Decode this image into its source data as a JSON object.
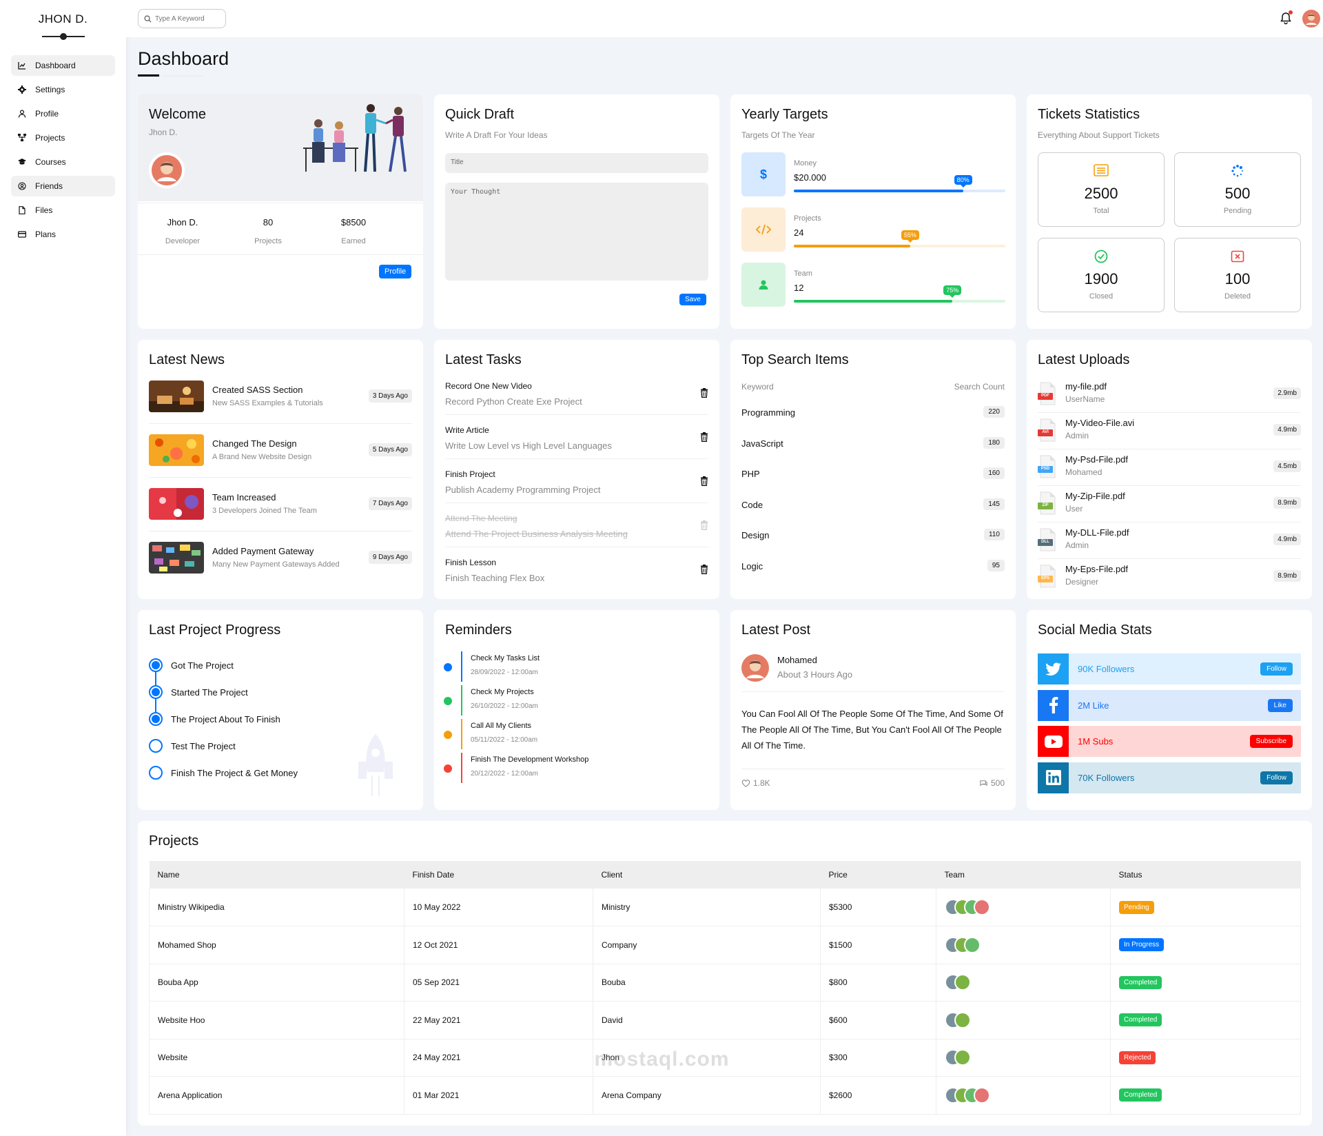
{
  "brand": "JHON D.",
  "nav": [
    {
      "label": "Dashboard",
      "icon": "chart-icon",
      "active": true
    },
    {
      "label": "Settings",
      "icon": "gear-icon",
      "active": false
    },
    {
      "label": "Profile",
      "icon": "user-icon",
      "active": false
    },
    {
      "label": "Projects",
      "icon": "diagram-icon",
      "active": false
    },
    {
      "label": "Courses",
      "icon": "graduation-cap-icon",
      "active": false
    },
    {
      "label": "Friends",
      "icon": "friends-icon",
      "active": true
    },
    {
      "label": "Files",
      "icon": "file-icon",
      "active": false
    },
    {
      "label": "Plans",
      "icon": "credit-card-icon",
      "active": false
    }
  ],
  "search": {
    "placeholder": "Type A Keyword"
  },
  "page_title": "Dashboard",
  "welcome": {
    "title": "Welcome",
    "name": "Jhon D.",
    "stats": [
      {
        "value": "Jhon D.",
        "label": "Developer"
      },
      {
        "value": "80",
        "label": "Projects"
      },
      {
        "value": "$8500",
        "label": "Earned"
      }
    ],
    "button": "Profile"
  },
  "quick_draft": {
    "title": "Quick Draft",
    "subtitle": "Write A Draft For Your Ideas",
    "title_placeholder": "Title",
    "body_placeholder": "Your Thought",
    "button": "Save"
  },
  "yearly_targets": {
    "title": "Yearly Targets",
    "subtitle": "Targets Of The Year",
    "items": [
      {
        "label": "Money",
        "value": "$20.000",
        "percent": 80,
        "badge": "80%",
        "color": "#0075ff",
        "bg": "#d7e9ff",
        "track": "#dceaff",
        "icon": "dollar-icon"
      },
      {
        "label": "Projects",
        "value": "24",
        "percent": 55,
        "badge": "55%",
        "color": "#f59e0b",
        "bg": "#fdecd6",
        "track": "#fdf0db",
        "icon": "code-icon"
      },
      {
        "label": "Team",
        "value": "12",
        "percent": 75,
        "badge": "75%",
        "color": "#22c55e",
        "bg": "#d8f5e1",
        "track": "#dcf5e4",
        "icon": "user-icon"
      }
    ]
  },
  "tickets": {
    "title": "Tickets Statistics",
    "subtitle": "Everything About Support Tickets",
    "items": [
      {
        "value": "2500",
        "label": "Total",
        "color": "#f59e0b",
        "icon": "list-icon"
      },
      {
        "value": "500",
        "label": "Pending",
        "color": "#0075ff",
        "icon": "spinner-icon"
      },
      {
        "value": "1900",
        "label": "Closed",
        "color": "#22c55e",
        "icon": "check-circle-icon"
      },
      {
        "value": "100",
        "label": "Deleted",
        "color": "#f44336",
        "icon": "x-square-icon"
      }
    ]
  },
  "latest_news": {
    "title": "Latest News",
    "items": [
      {
        "title": "Created SASS Section",
        "desc": "New SASS Examples & Tutorials",
        "time": "3 Days Ago"
      },
      {
        "title": "Changed The Design",
        "desc": "A Brand New Website Design",
        "time": "5 Days Ago"
      },
      {
        "title": "Team Increased",
        "desc": "3 Developers Joined The Team",
        "time": "7 Days Ago"
      },
      {
        "title": "Added Payment Gateway",
        "desc": "Many New Payment Gateways Added",
        "time": "9 Days Ago"
      }
    ]
  },
  "latest_tasks": {
    "title": "Latest Tasks",
    "items": [
      {
        "title": "Record One New Video",
        "desc": "Record Python Create Exe Project",
        "done": false
      },
      {
        "title": "Write Article",
        "desc": "Write Low Level vs High Level Languages",
        "done": false
      },
      {
        "title": "Finish Project",
        "desc": "Publish Academy Programming Project",
        "done": false
      },
      {
        "title": "Attend The Meeting",
        "desc": "Attend The Project Business Analysis Meeting",
        "done": true
      },
      {
        "title": "Finish Lesson",
        "desc": "Finish Teaching Flex Box",
        "done": false
      }
    ]
  },
  "top_search": {
    "title": "Top Search Items",
    "col_keyword": "Keyword",
    "col_count": "Search Count",
    "items": [
      {
        "keyword": "Programming",
        "count": "220"
      },
      {
        "keyword": "JavaScript",
        "count": "180"
      },
      {
        "keyword": "PHP",
        "count": "160"
      },
      {
        "keyword": "Code",
        "count": "145"
      },
      {
        "keyword": "Design",
        "count": "110"
      },
      {
        "keyword": "Logic",
        "count": "95"
      }
    ]
  },
  "latest_uploads": {
    "title": "Latest Uploads",
    "items": [
      {
        "name": "my-file.pdf",
        "user": "UserName",
        "size": "2.9mb",
        "ext": "PDF",
        "color": "#e53935"
      },
      {
        "name": "My-Video-File.avi",
        "user": "Admin",
        "size": "4.9mb",
        "ext": "AVI",
        "color": "#e53935"
      },
      {
        "name": "My-Psd-File.pdf",
        "user": "Mohamed",
        "size": "4.5mb",
        "ext": "PSD",
        "color": "#42a5f5"
      },
      {
        "name": "My-Zip-File.pdf",
        "user": "User",
        "size": "8.9mb",
        "ext": "ZIP",
        "color": "#7cb342"
      },
      {
        "name": "My-DLL-File.pdf",
        "user": "Admin",
        "size": "4.9mb",
        "ext": "DLL",
        "color": "#546e7a"
      },
      {
        "name": "My-Eps-File.pdf",
        "user": "Designer",
        "size": "8.9mb",
        "ext": "EPS",
        "color": "#ffb74d"
      }
    ]
  },
  "project_progress": {
    "title": "Last Project Progress",
    "items": [
      {
        "label": "Got The Project",
        "done": true
      },
      {
        "label": "Started The Project",
        "done": true
      },
      {
        "label": "The Project About To Finish",
        "done": true
      },
      {
        "label": "Test The Project",
        "done": false
      },
      {
        "label": "Finish The Project & Get Money",
        "done": false
      }
    ]
  },
  "reminders": {
    "title": "Reminders",
    "items": [
      {
        "title": "Check My Tasks List",
        "date": "28/09/2022 - 12:00am",
        "color": "#0075ff"
      },
      {
        "title": "Check My Projects",
        "date": "26/10/2022 - 12:00am",
        "color": "#22c55e"
      },
      {
        "title": "Call All My Clients",
        "date": "05/11/2022 - 12:00am",
        "color": "#f59e0b"
      },
      {
        "title": "Finish The Development Workshop",
        "date": "20/12/2022 - 12:00am",
        "color": "#f44336"
      }
    ]
  },
  "latest_post": {
    "title": "Latest Post",
    "author": "Mohamed",
    "time": "About 3 Hours Ago",
    "text": "You Can Fool All Of The People Some Of The Time, And Some Of The People All Of The Time, But You Can't Fool All Of The People All Of The Time.",
    "likes": "1.8K",
    "comments": "500"
  },
  "social": {
    "title": "Social Media Stats",
    "items": [
      {
        "label": "90K Followers",
        "button": "Follow",
        "color": "#1da1f2",
        "bg": "#dff0fe",
        "icon": "twitter-icon"
      },
      {
        "label": "2M Like",
        "button": "Like",
        "color": "#1877f2",
        "bg": "#dbe9fd",
        "icon": "facebook-icon"
      },
      {
        "label": "1M Subs",
        "button": "Subscribe",
        "color": "#ff0000",
        "bg": "#ffd6d6",
        "icon": "youtube-icon"
      },
      {
        "label": "70K Followers",
        "button": "Follow",
        "color": "#0e76a8",
        "bg": "#d5e7f1",
        "icon": "linkedin-icon"
      }
    ]
  },
  "projects": {
    "title": "Projects",
    "columns": [
      "Name",
      "Finish Date",
      "Client",
      "Price",
      "Team",
      "Status"
    ],
    "rows": [
      {
        "name": "Ministry Wikipedia",
        "date": "10 May 2022",
        "client": "Ministry",
        "price": "$5300",
        "team": 4,
        "status": "Pending",
        "status_color": "#f59e0b"
      },
      {
        "name": "Mohamed Shop",
        "date": "12 Oct 2021",
        "client": "Company",
        "price": "$1500",
        "team": 3,
        "status": "In Progress",
        "status_color": "#0075ff"
      },
      {
        "name": "Bouba App",
        "date": "05 Sep 2021",
        "client": "Bouba",
        "price": "$800",
        "team": 2,
        "status": "Completed",
        "status_color": "#22c55e"
      },
      {
        "name": "Website Hoo",
        "date": "22 May 2021",
        "client": "David",
        "price": "$600",
        "team": 2,
        "status": "Completed",
        "status_color": "#22c55e"
      },
      {
        "name": "Website",
        "date": "24 May 2021",
        "client": "Jhon",
        "price": "$300",
        "team": 2,
        "status": "Rejected",
        "status_color": "#f44336"
      },
      {
        "name": "Arena Application",
        "date": "01 Mar 2021",
        "client": "Arena Company",
        "price": "$2600",
        "team": 4,
        "status": "Completed",
        "status_color": "#22c55e"
      }
    ]
  },
  "watermark": "mostaql.com"
}
